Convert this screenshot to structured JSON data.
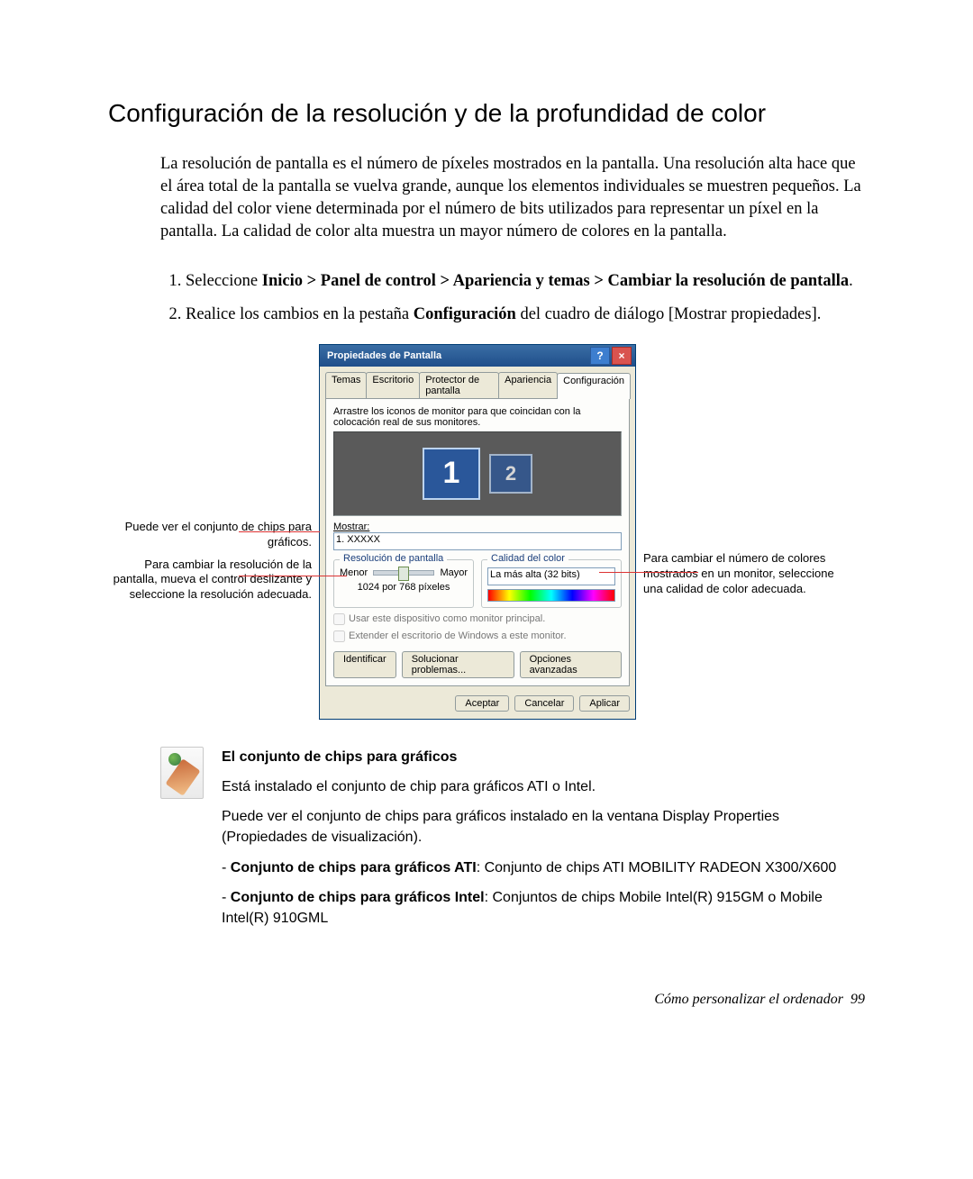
{
  "title": "Configuración de la resolución y de la profundidad de color",
  "intro": "La resolución de pantalla es el número de píxeles mostrados en la pantalla. Una resolución alta hace que el área total de la pantalla se vuelva grande, aunque los elementos individuales se muestren pequeños. La calidad del color viene determinada por el número de bits utilizados para representar un píxel en la pantalla. La calidad de color alta muestra un mayor número de colores en la pantalla.",
  "steps": {
    "s1_pre": "Seleccione ",
    "s1_bold": "Inicio > Panel de control > Apariencia y temas > Cambiar la resolución de pantalla",
    "s1_post": ".",
    "s2_pre": "Realice los cambios en la pestaña ",
    "s2_bold": "Configuración",
    "s2_post": " del cuadro de diálogo [Mostrar propiedades]."
  },
  "callouts": {
    "left1": "Puede ver el conjunto de chips para gráficos.",
    "left2": "Para cambiar la resolución de la pantalla, mueva el control deslizante y seleccione la resolución adecuada.",
    "right1": "Para cambiar el número de colores mostrados en un monitor, seleccione una calidad de color adecuada."
  },
  "dialog": {
    "title": "Propiedades de Pantalla",
    "help": "?",
    "close": "×",
    "tabs": [
      "Temas",
      "Escritorio",
      "Protector de pantalla",
      "Apariencia",
      "Configuración"
    ],
    "active_tab": 4,
    "hint": "Arrastre los iconos de monitor para que coincidan con la colocación real de sus monitores.",
    "mon1": "1",
    "mon2": "2",
    "mostrar_label": "Mostrar:",
    "mostrar_value": "1. XXXXX",
    "grp_res": "Resolución de pantalla",
    "res_min": "Menor",
    "res_max": "Mayor",
    "res_value": "1024 por 768 píxeles",
    "grp_color": "Calidad del color",
    "color_value": "La más alta (32 bits)",
    "chk1": "Usar este dispositivo como monitor principal.",
    "chk2": "Extender el escritorio de Windows a este monitor.",
    "btn_ident": "Identificar",
    "btn_trouble": "Solucionar problemas...",
    "btn_adv": "Opciones avanzadas",
    "btn_ok": "Aceptar",
    "btn_cancel": "Cancelar",
    "btn_apply": "Aplicar"
  },
  "note": {
    "title": "El conjunto de chips para gráficos",
    "p1": "Está instalado el conjunto de chip para gráficos ATI o Intel.",
    "p2": "Puede ver el conjunto de chips para gráficos instalado en la ventana Display Properties (Propiedades de visualización).",
    "ati_b": "Conjunto de chips para gráficos ATI",
    "ati_r": ": Conjunto de chips ATI MOBILITY RADEON X300/X600",
    "intel_b": "Conjunto de chips para gráficos Intel",
    "intel_r": ": Conjuntos de chips Mobile Intel(R) 915GM o Mobile Intel(R) 910GML"
  },
  "footer": {
    "text": "Cómo personalizar el ordenador",
    "page": "99"
  }
}
